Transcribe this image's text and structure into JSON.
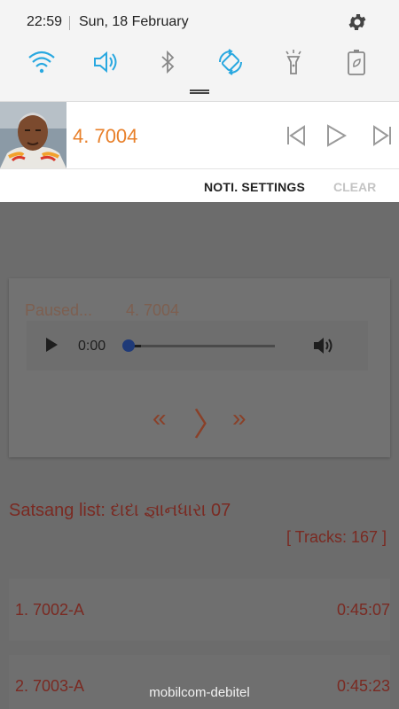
{
  "status_bar": {
    "time": "22:59",
    "date": "Sun, 18 February",
    "settings_icon": "gear-icon"
  },
  "quick_settings": [
    {
      "name": "wifi",
      "icon": "wifi-icon",
      "active": true
    },
    {
      "name": "sound",
      "icon": "volume-icon",
      "active": true
    },
    {
      "name": "bluetooth",
      "icon": "bluetooth-icon",
      "active": false
    },
    {
      "name": "auto-rotate",
      "icon": "rotate-icon",
      "active": true
    },
    {
      "name": "flashlight",
      "icon": "flashlight-icon",
      "active": false
    },
    {
      "name": "power-saving",
      "icon": "battery-saver-icon",
      "active": false
    }
  ],
  "media_notification": {
    "title": "4. 7004",
    "controls": [
      "previous",
      "play",
      "next"
    ],
    "settings_label": "NOTI. SETTINGS",
    "clear_label": "CLEAR"
  },
  "player": {
    "status": "Paused...",
    "track": "4. 7004",
    "time": "0:00",
    "prev_symbol": "«",
    "next_symbol": "»",
    "toggle_symbol": "〉"
  },
  "list": {
    "title": "Satsang list: દાદા જ્ઞાનધારા 07",
    "tracks_label": "[ Tracks: 167 ]",
    "rows": [
      {
        "name": "1. 7002-A",
        "duration": "0:45:07"
      },
      {
        "name": "2. 7003-A",
        "duration": "0:45:23"
      }
    ]
  },
  "carrier": "mobilcom-debitel",
  "colors": {
    "accent": "#29a8e0",
    "title_orange": "#e8802a",
    "list_text": "#7a2a22"
  }
}
